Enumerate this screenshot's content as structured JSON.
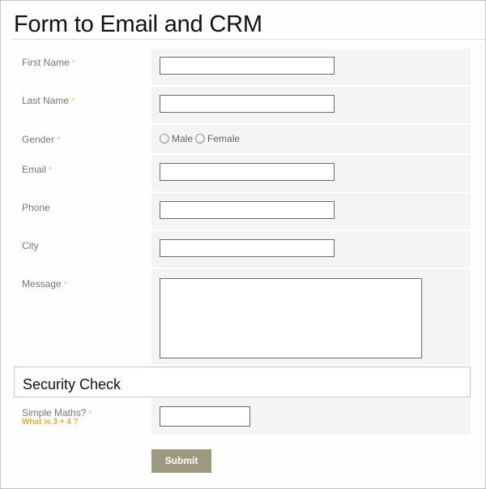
{
  "form": {
    "title": "Form to Email and CRM",
    "required_marker": "*",
    "fields": {
      "first_name": {
        "label": "First Name",
        "required": true,
        "value": ""
      },
      "last_name": {
        "label": "Last Name",
        "required": true,
        "value": ""
      },
      "gender": {
        "label": "Gender",
        "required": true,
        "options": [
          "Male",
          "Female"
        ],
        "selected": null
      },
      "email": {
        "label": "Email",
        "required": true,
        "value": ""
      },
      "phone": {
        "label": "Phone",
        "required": false,
        "value": ""
      },
      "city": {
        "label": "City",
        "required": false,
        "value": ""
      },
      "message": {
        "label": "Message",
        "required": true,
        "value": ""
      }
    },
    "security": {
      "heading": "Security Check",
      "label": "Simple Maths?",
      "hint": "What is 3 + 4 ?",
      "value": ""
    },
    "submit_label": "Submit"
  },
  "colors": {
    "required": "#e7c56a",
    "hint": "#e0b030",
    "submit_bg": "#9c9a7e",
    "field_bg": "#f4f4f4"
  }
}
